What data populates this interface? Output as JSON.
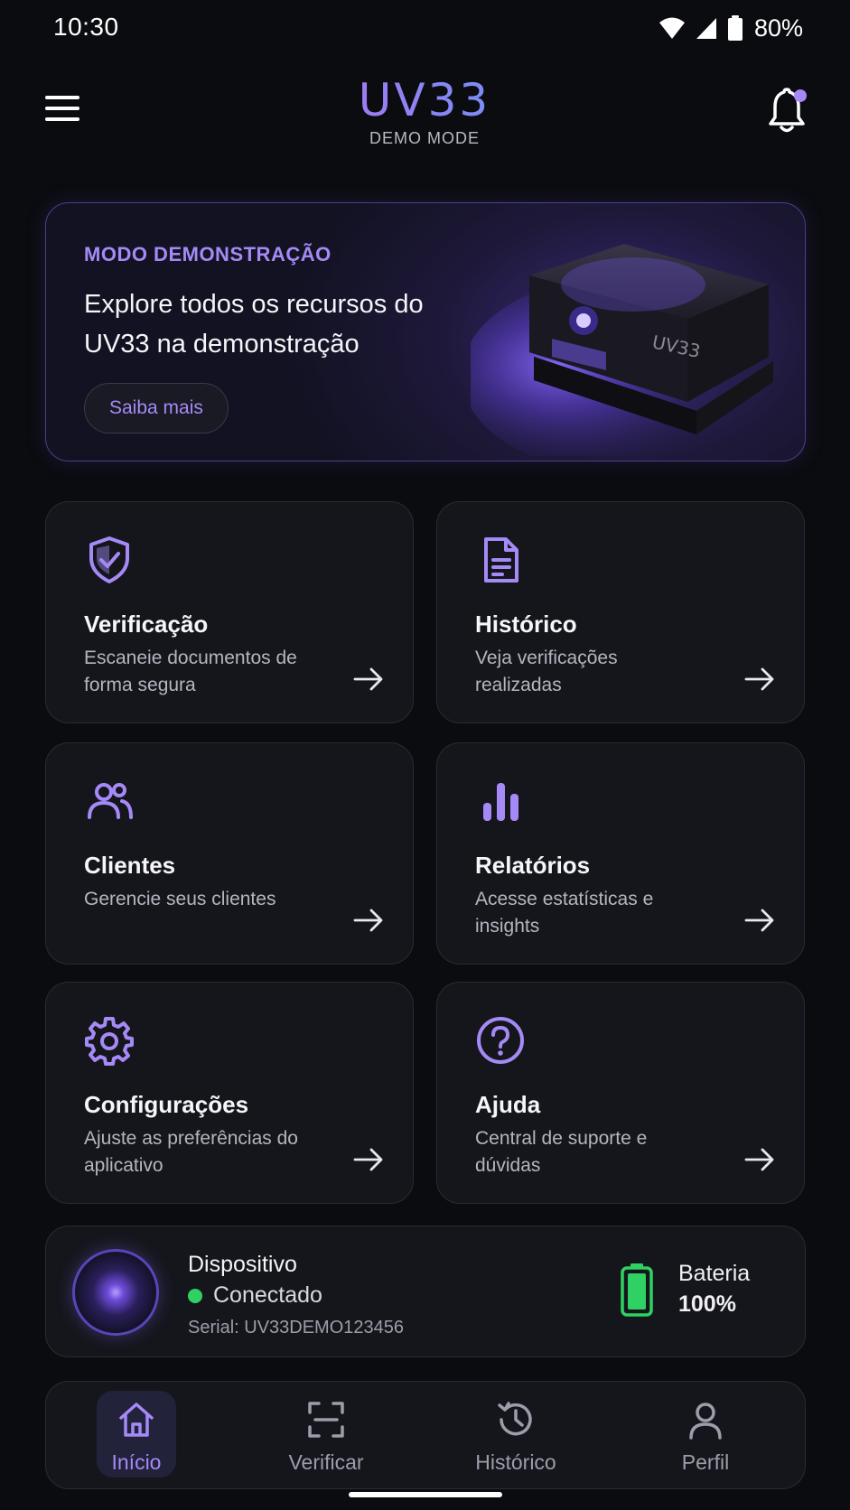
{
  "status_bar": {
    "time": "10:30",
    "battery_percent": "80%",
    "icons": [
      "wifi-icon",
      "signal-icon",
      "battery-icon"
    ]
  },
  "header": {
    "logo_text": "UV33",
    "logo_subtitle": "DEMO MODE",
    "menu_icon": "menu-icon",
    "notification_icon": "bell-icon",
    "notification_dot": true
  },
  "banner": {
    "eyebrow": "MODO DEMONSTRAÇÃO",
    "title": "Explore todos os recursos do UV33 na demonstração",
    "button_label": "Saiba mais",
    "device_brand": "UV33"
  },
  "cards": [
    {
      "icon": "shield-check-icon",
      "title": "Verificação",
      "desc": "Escaneie documentos de forma segura"
    },
    {
      "icon": "document-icon",
      "title": "Histórico",
      "desc": "Veja verificações realizadas"
    },
    {
      "icon": "users-icon",
      "title": "Clientes",
      "desc": "Gerencie seus clientes"
    },
    {
      "icon": "bar-chart-icon",
      "title": "Relatórios",
      "desc": "Acesse estatísticas e insights"
    },
    {
      "icon": "gear-icon",
      "title": "Configurações",
      "desc": "Ajuste as preferências do aplicativo"
    },
    {
      "icon": "help-circle-icon",
      "title": "Ajuda",
      "desc": "Central de suporte e dúvidas"
    }
  ],
  "device": {
    "title": "Dispositivo",
    "status": "Conectado",
    "serial": "Serial: UV33DEMO123456",
    "battery_label": "Bateria",
    "battery_value": "100%",
    "battery_level": 1.0
  },
  "bottom_nav": [
    {
      "icon": "home-icon",
      "label": "Início",
      "active": true
    },
    {
      "icon": "scan-icon",
      "label": "Verificar",
      "active": false
    },
    {
      "icon": "history-icon",
      "label": "Histórico",
      "active": false
    },
    {
      "icon": "user-icon",
      "label": "Perfil",
      "active": false
    }
  ],
  "colors": {
    "accent": "#a58af7",
    "background": "#0b0c10",
    "card": "#15161c",
    "success": "#2fd162"
  }
}
